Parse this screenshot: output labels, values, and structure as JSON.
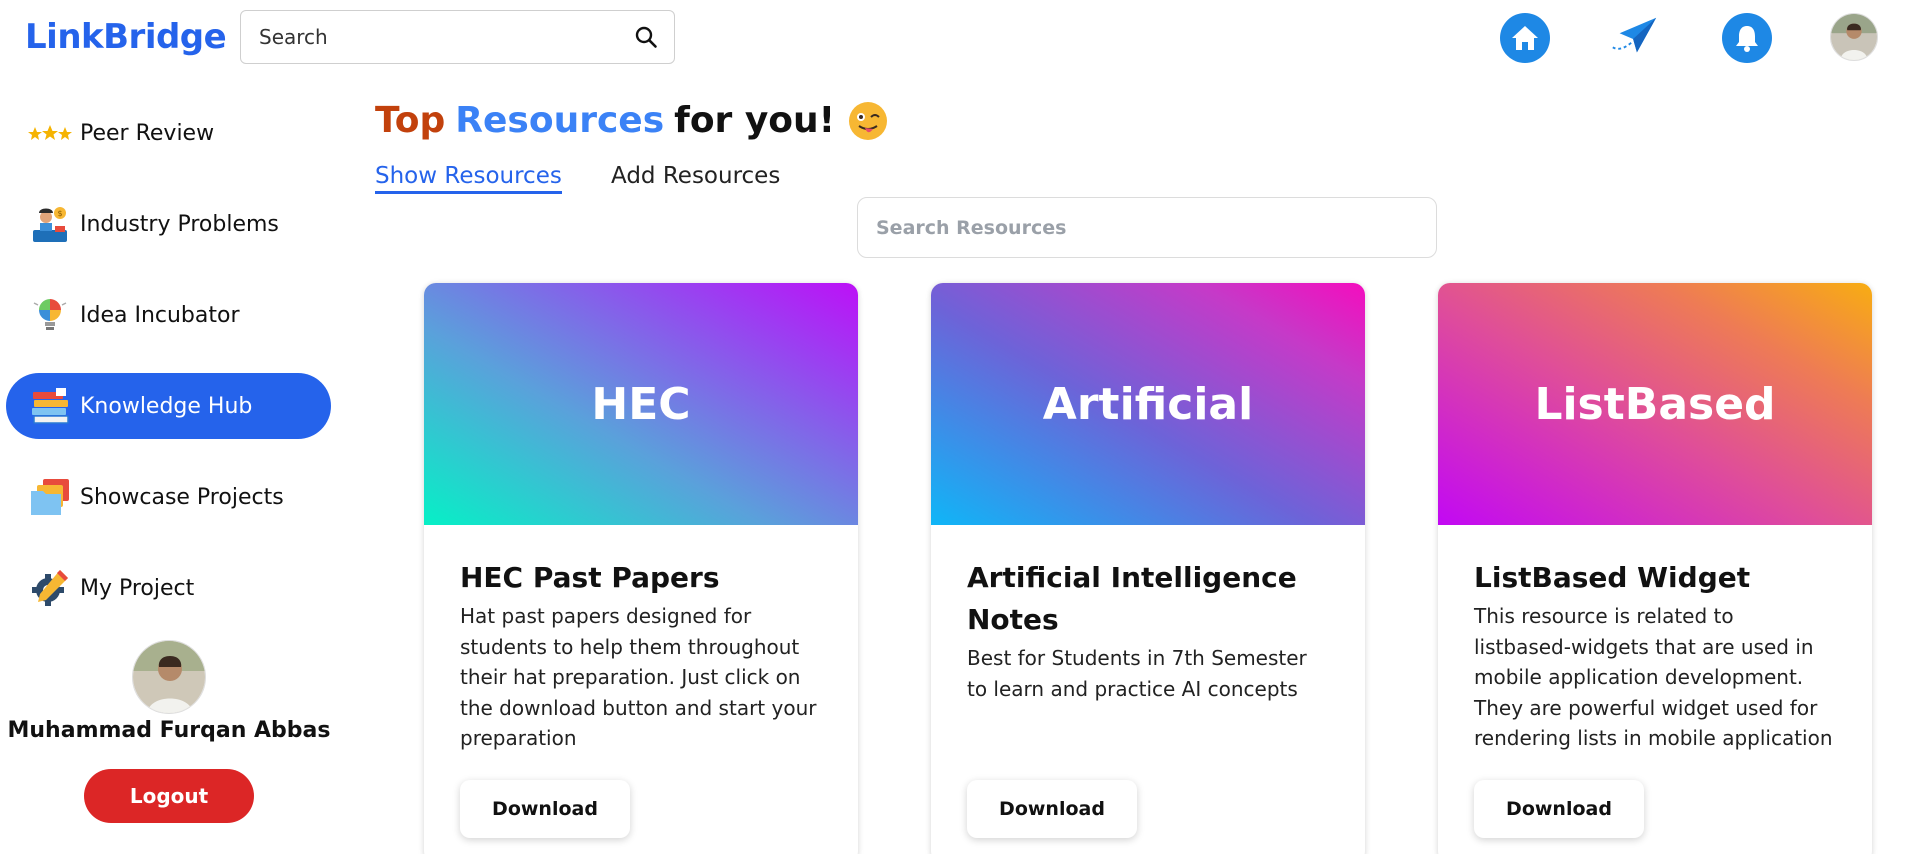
{
  "header": {
    "logo": "LinkBridge",
    "search_placeholder": "Search",
    "icons": [
      "search-icon",
      "home-icon",
      "send-icon",
      "bell-icon",
      "avatar"
    ]
  },
  "sidebar": {
    "items": [
      {
        "label": "Peer Review",
        "icon": "stars-icon",
        "active": false
      },
      {
        "label": "Industry Problems",
        "icon": "worker-icon",
        "active": false
      },
      {
        "label": "Idea Incubator",
        "icon": "lightbulb-icon",
        "active": false
      },
      {
        "label": "Knowledge Hub",
        "icon": "books-icon",
        "active": true
      },
      {
        "label": "Showcase Projects",
        "icon": "folders-icon",
        "active": false
      },
      {
        "label": "My Project",
        "icon": "gear-pencil-icon",
        "active": false
      }
    ],
    "profile_name": "Muhammad Furqan Abbas",
    "logout_label": "Logout"
  },
  "main": {
    "title_part1": "Top",
    "title_part2": "Resources",
    "title_part3": "for you!",
    "tabs": [
      {
        "label": "Show Resources",
        "active": true
      },
      {
        "label": "Add Resources",
        "active": false
      }
    ],
    "search_placeholder": "Search Resources",
    "cards": [
      {
        "banner": "HEC",
        "title": "HEC Past Papers",
        "description": "Hat past papers designed for students to help them throughout their hat preparation. Just click on the download button and start your preparation",
        "button": "Download"
      },
      {
        "banner": "Artificial",
        "title": "Artificial Intelligence Notes",
        "description": "Best for Students in 7th Semester to learn and practice AI concepts",
        "button": "Download"
      },
      {
        "banner": "ListBased",
        "title": "ListBased Widget",
        "description": "This resource is related to listbased-widgets that are used in mobile application development. They are powerful widget used for rendering lists in mobile application",
        "button": "Download"
      }
    ]
  },
  "colors": {
    "brand": "#2563eb",
    "logout": "#dc2626",
    "title_top": "#c2410c",
    "title_resources": "#3b82f6"
  }
}
